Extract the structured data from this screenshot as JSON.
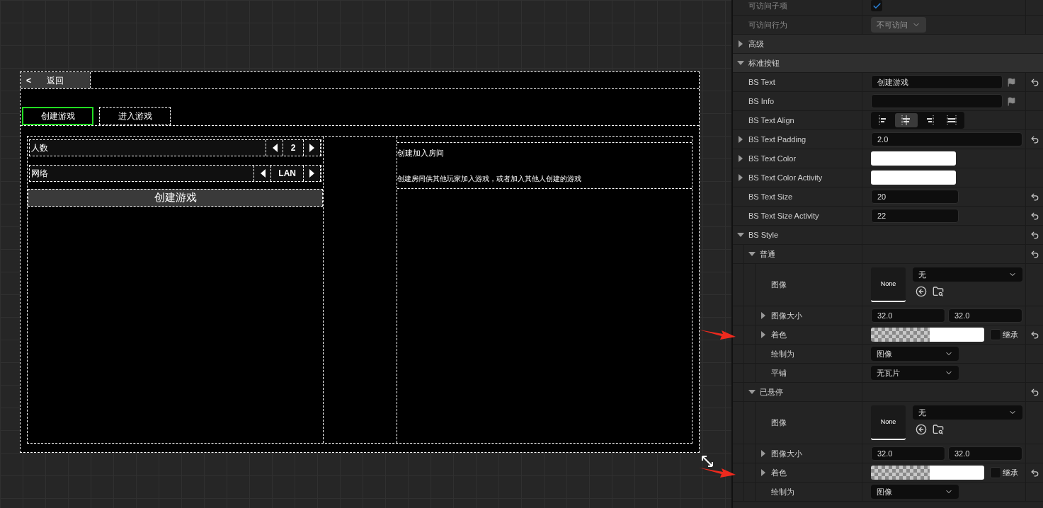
{
  "canvas": {
    "back_button": {
      "icon": "<",
      "label": "返回"
    },
    "tabs": [
      {
        "label": "创建游戏",
        "selected": true
      },
      {
        "label": "进入游戏",
        "selected": false
      }
    ],
    "settings": [
      {
        "label": "人数",
        "value": "2"
      },
      {
        "label": "网络",
        "value": "LAN"
      }
    ],
    "create_button": "创建游戏",
    "info": {
      "title": "创建加入房间",
      "description": "创建房间供其他玩家加入游戏，或者加入其他人创建的游戏"
    }
  },
  "panel": {
    "rows": [
      {
        "kind": "checkbox",
        "label": "可访问子项",
        "checked": true,
        "disabled": true
      },
      {
        "kind": "dropdown",
        "label": "可访问行为",
        "value": "不可访问",
        "disabled": true
      },
      {
        "kind": "category",
        "label": "高级",
        "expanded": false
      },
      {
        "kind": "category",
        "label": "标准按钮",
        "expanded": true,
        "children": [
          {
            "kind": "text",
            "label": "BS Text",
            "value": "创建游戏",
            "reset": true
          },
          {
            "kind": "text",
            "label": "BS Info",
            "reset": false
          },
          {
            "kind": "align",
            "label": "BS Text Align",
            "options": [
              {
                "kind": "left",
                "selected": false
              },
              {
                "kind": "center",
                "selected": true
              },
              {
                "kind": "right",
                "selected": false
              },
              {
                "kind": "fill",
                "selected": false
              }
            ]
          },
          {
            "kind": "number",
            "label": "BS Text Padding",
            "value": "2.0",
            "wide": true,
            "expanded": false,
            "reset": true
          },
          {
            "kind": "color",
            "label": "BS Text Color",
            "color": "#ffffff",
            "expanded": false,
            "reset": false
          },
          {
            "kind": "color",
            "label": "BS Text Color Activity",
            "color": "#ffffff",
            "expanded": false,
            "reset": false
          },
          {
            "kind": "number",
            "label": "BS Text Size",
            "value": "20",
            "wide": false,
            "reset": true
          },
          {
            "kind": "number",
            "label": "BS Text Size Activity",
            "value": "22",
            "wide": false,
            "reset": true
          },
          {
            "kind": "group",
            "label": "BS Style",
            "expanded": true,
            "reset": true,
            "children": [
              {
                "kind": "group",
                "label": "普通",
                "expanded": true,
                "reset": true,
                "children": [
                  {
                    "kind": "image",
                    "label": "图像",
                    "preview": "None",
                    "value": "无"
                  },
                  {
                    "kind": "pair",
                    "label": "图像大小",
                    "values": [
                      "32.0",
                      "32.0"
                    ],
                    "expanded": false
                  },
                  {
                    "kind": "tint",
                    "label": "着色",
                    "expanded": false,
                    "inherit_label": "继承",
                    "inherit": false,
                    "reset": true,
                    "annotated": true
                  },
                  {
                    "kind": "select",
                    "label": "绘制为",
                    "value": "图像"
                  },
                  {
                    "kind": "select",
                    "label": "平铺",
                    "value": "无瓦片"
                  }
                ]
              },
              {
                "kind": "group",
                "label": "已悬停",
                "expanded": true,
                "reset": true,
                "children": [
                  {
                    "kind": "image",
                    "label": "图像",
                    "preview": "None",
                    "value": "无"
                  },
                  {
                    "kind": "pair",
                    "label": "图像大小",
                    "values": [
                      "32.0",
                      "32.0"
                    ],
                    "expanded": false
                  },
                  {
                    "kind": "tint",
                    "label": "着色",
                    "expanded": false,
                    "inherit_label": "继承",
                    "inherit": false,
                    "reset": true,
                    "annotated": true
                  },
                  {
                    "kind": "select",
                    "label": "绘制为",
                    "value": "图像"
                  }
                ]
              }
            ]
          }
        ]
      }
    ]
  }
}
